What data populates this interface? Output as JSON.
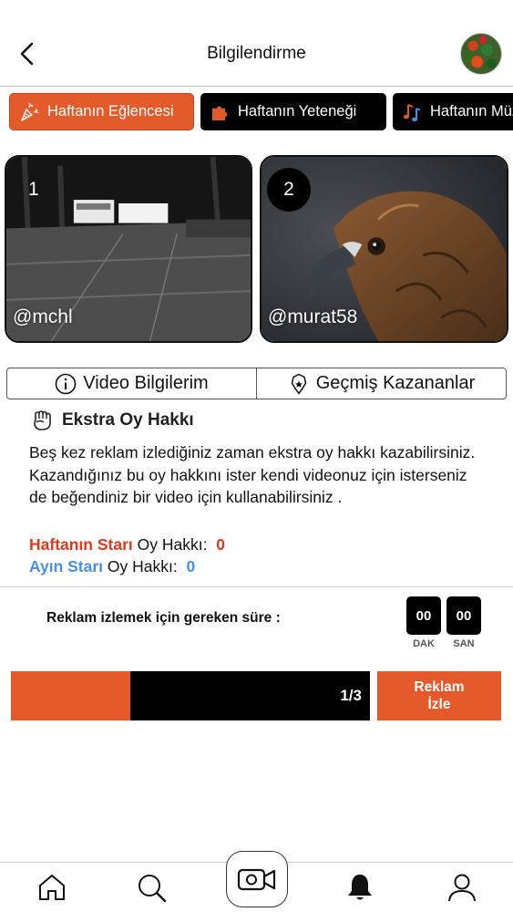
{
  "header": {
    "title": "Bilgilendirme"
  },
  "tabs": [
    {
      "label": "Haftanın Eğlencesi",
      "active": true,
      "icon": "party-popper-icon"
    },
    {
      "label": "Haftanın Yeteneği",
      "active": false,
      "icon": "puzzle-icon"
    },
    {
      "label": "Haftanın Müziği",
      "active": false,
      "icon": "music-note-icon"
    }
  ],
  "videos": [
    {
      "rank": "1",
      "handle": "@mchl"
    },
    {
      "rank": "2",
      "handle": "@murat58"
    }
  ],
  "segments": {
    "video_info": "Video Bilgilerim",
    "past_winners": "Geçmiş Kazananlar"
  },
  "info": {
    "title": "Ekstra Oy Hakkı",
    "text": "Beş kez reklam izlediğiniz zaman ekstra oy hakkı kazabilirsiniz. Kazandığınız bu oy hakkını ister kendi videonuz için isterseniz de beğendiniz bir video için kullanabilirsiniz .",
    "week_star_label": "Haftanın Starı",
    "month_star_label": "Ayın Starı",
    "vote_label": "Oy Hakkı:",
    "week_star_votes": "0",
    "month_star_votes": "0"
  },
  "countdown": {
    "label": "Reklam izlemek için gereken süre :",
    "minutes": "00",
    "seconds": "00",
    "minutes_unit": "DAK",
    "seconds_unit": "SAN"
  },
  "progress": {
    "text": "1/3",
    "fraction": 0.333
  },
  "watch_button": {
    "line1": "Reklam",
    "line2": "İzle"
  },
  "colors": {
    "accent": "#e3592a",
    "week_star": "#e03a1e",
    "month_star": "#4a90e2",
    "dark": "#000000"
  }
}
